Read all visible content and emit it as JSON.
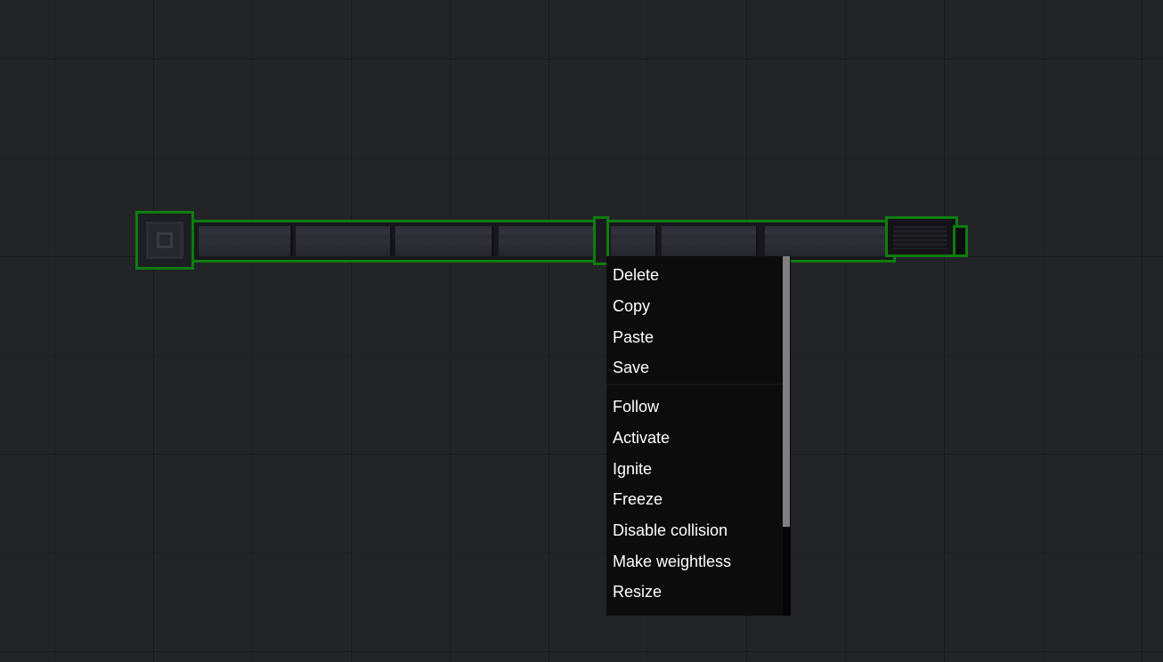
{
  "scene": {
    "selection_color": "#0f7d0f",
    "background_color": "#232427",
    "object_name": "rod-object"
  },
  "context_menu": {
    "groups": [
      [
        "Delete",
        "Copy",
        "Paste",
        "Save"
      ],
      [
        "Follow",
        "Activate",
        "Ignite",
        "Freeze",
        "Disable collision",
        "Make weightless",
        "Resize"
      ]
    ],
    "items": {
      "delete": "Delete",
      "copy": "Copy",
      "paste": "Paste",
      "save": "Save",
      "follow": "Follow",
      "activate": "Activate",
      "ignite": "Ignite",
      "freeze": "Freeze",
      "disable_collision": "Disable collision",
      "make_weightless": "Make weightless",
      "resize": "Resize"
    },
    "scrollbar_thumb_color": "#808080",
    "scroll_position_fraction": 0.0
  }
}
